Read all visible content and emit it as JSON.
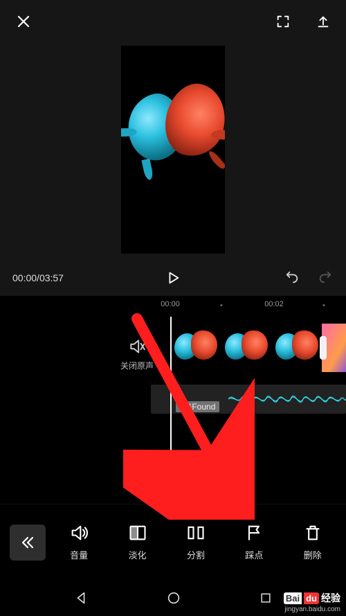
{
  "colors": {
    "bg": "#000000",
    "panel": "#161616",
    "accent_red": "#e33",
    "wave": "#2ac7d1"
  },
  "transport": {
    "current_time": "00:00",
    "total_time": "03:57",
    "separator": "/"
  },
  "timeline": {
    "ruler": {
      "mark0": "00:00",
      "mark1": "00:02"
    },
    "mute_label": "关闭原声",
    "audio_clip_name": "st&Found"
  },
  "toolbar": {
    "items": [
      {
        "id": "volume",
        "label": "音量"
      },
      {
        "id": "fade",
        "label": "淡化"
      },
      {
        "id": "split",
        "label": "分割"
      },
      {
        "id": "beat",
        "label": "踩点"
      },
      {
        "id": "delete",
        "label": "删除"
      }
    ]
  },
  "watermark": {
    "brand1": "Bai",
    "brand2": "du",
    "text": "经验",
    "url": "jingyan.baidu.com"
  }
}
